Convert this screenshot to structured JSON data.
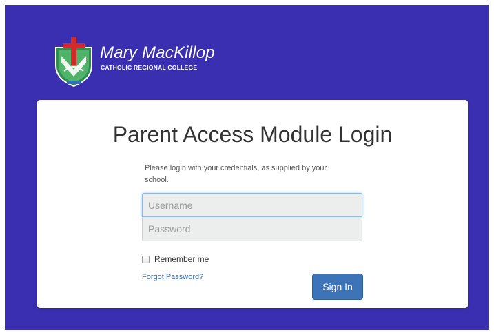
{
  "colors": {
    "background": "#3a2fb0",
    "card": "#ffffff",
    "primary_button": "#3d74b8",
    "link": "#3a6fb4"
  },
  "logo": {
    "name": "Mary MacKillop",
    "subtitle": "CATHOLIC REGIONAL COLLEGE",
    "icon": "school-crest-icon"
  },
  "login": {
    "title": "Parent Access Module Login",
    "instructions": "Please login with your credentials, as supplied by your school.",
    "username_placeholder": "Username",
    "password_placeholder": "Password",
    "remember_label": "Remember me",
    "forgot_label": "Forgot Password?",
    "signin_label": "Sign In"
  }
}
